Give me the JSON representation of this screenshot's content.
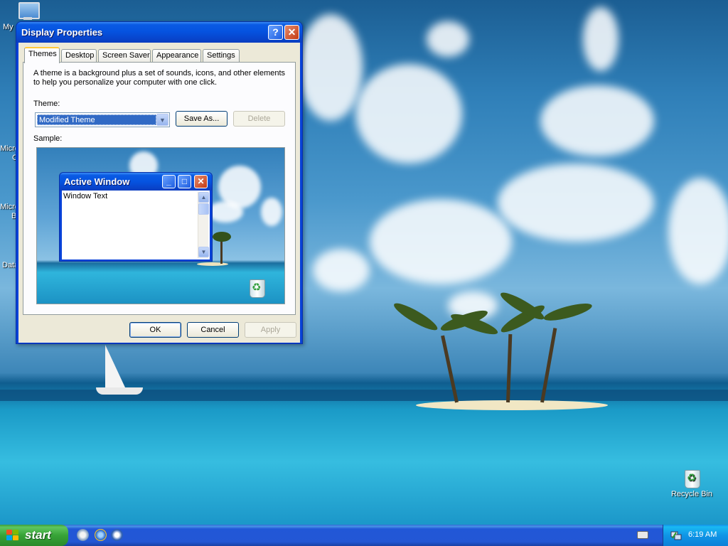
{
  "desktop": {
    "icons": [
      {
        "name": "My Computer",
        "shown": "My"
      },
      {
        "name": "Recycle Bin",
        "shown": "Recycle Bin"
      }
    ],
    "edge_labels": [
      "Micro",
      "C",
      "Micro",
      "B",
      "Data"
    ]
  },
  "window": {
    "title": "Display Properties",
    "help_glyph": "?",
    "close_glyph": "✕",
    "tabs": [
      {
        "label": "Themes",
        "active": true
      },
      {
        "label": "Desktop",
        "active": false
      },
      {
        "label": "Screen Saver",
        "active": false
      },
      {
        "label": "Appearance",
        "active": false
      },
      {
        "label": "Settings",
        "active": false
      }
    ],
    "themes_tab": {
      "description_line1": "A theme is a background plus a set of sounds, icons, and other elements",
      "description_line2": "to help you personalize your computer with one click.",
      "theme_label": "Theme:",
      "theme_value": "Modified Theme",
      "save_as_label": "Save As...",
      "delete_label": "Delete",
      "sample_label": "Sample:",
      "sample": {
        "window_title": "Active Window",
        "window_text": "Window Text"
      }
    },
    "buttons": {
      "ok": "OK",
      "cancel": "Cancel",
      "apply": "Apply"
    }
  },
  "taskbar": {
    "start_label": "start",
    "clock": "6:19 AM"
  },
  "colors": {
    "title_blue": "#0553e0",
    "start_green": "#37a337",
    "tray_blue": "#0f95e6",
    "selection_blue": "#316ac5"
  }
}
